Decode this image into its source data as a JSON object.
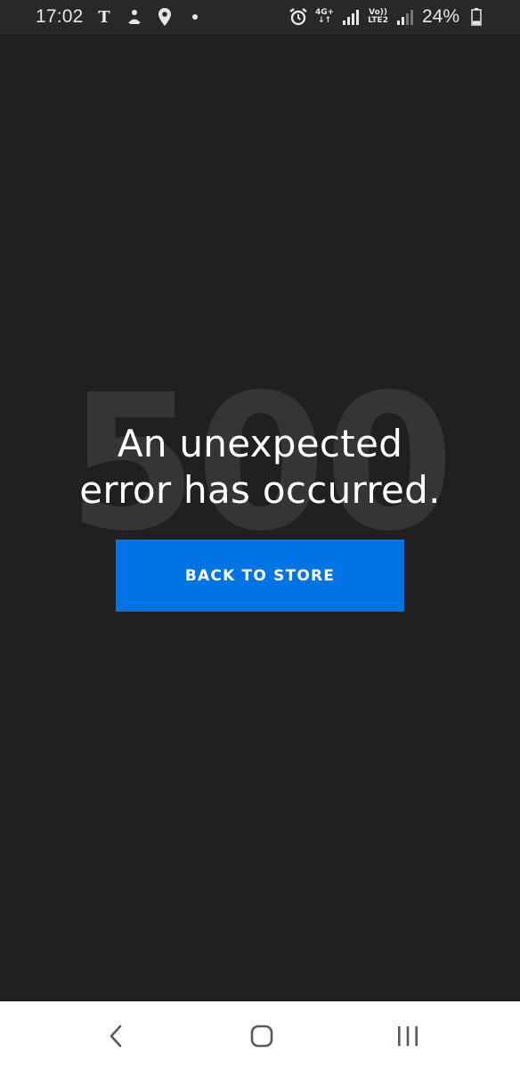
{
  "status_bar": {
    "time": "17:02",
    "left_icons": [
      "nyt-icon",
      "notification-app-icon",
      "location-icon",
      "dot-icon"
    ],
    "network_1": {
      "top": "4G+",
      "bottom": "↓↑"
    },
    "network_2": {
      "top": "Vo))",
      "bottom": "LTE2"
    },
    "battery_percent": "24%",
    "battery_level": 0.24
  },
  "error": {
    "code": "500",
    "title_line1": "An unexpected",
    "title_line2": "error has occurred."
  },
  "actions": {
    "back_label": "BACK TO STORE"
  },
  "colors": {
    "background": "#202020",
    "status_bar": "#282828",
    "accent": "#0074e4",
    "code_watermark": "#353535"
  }
}
